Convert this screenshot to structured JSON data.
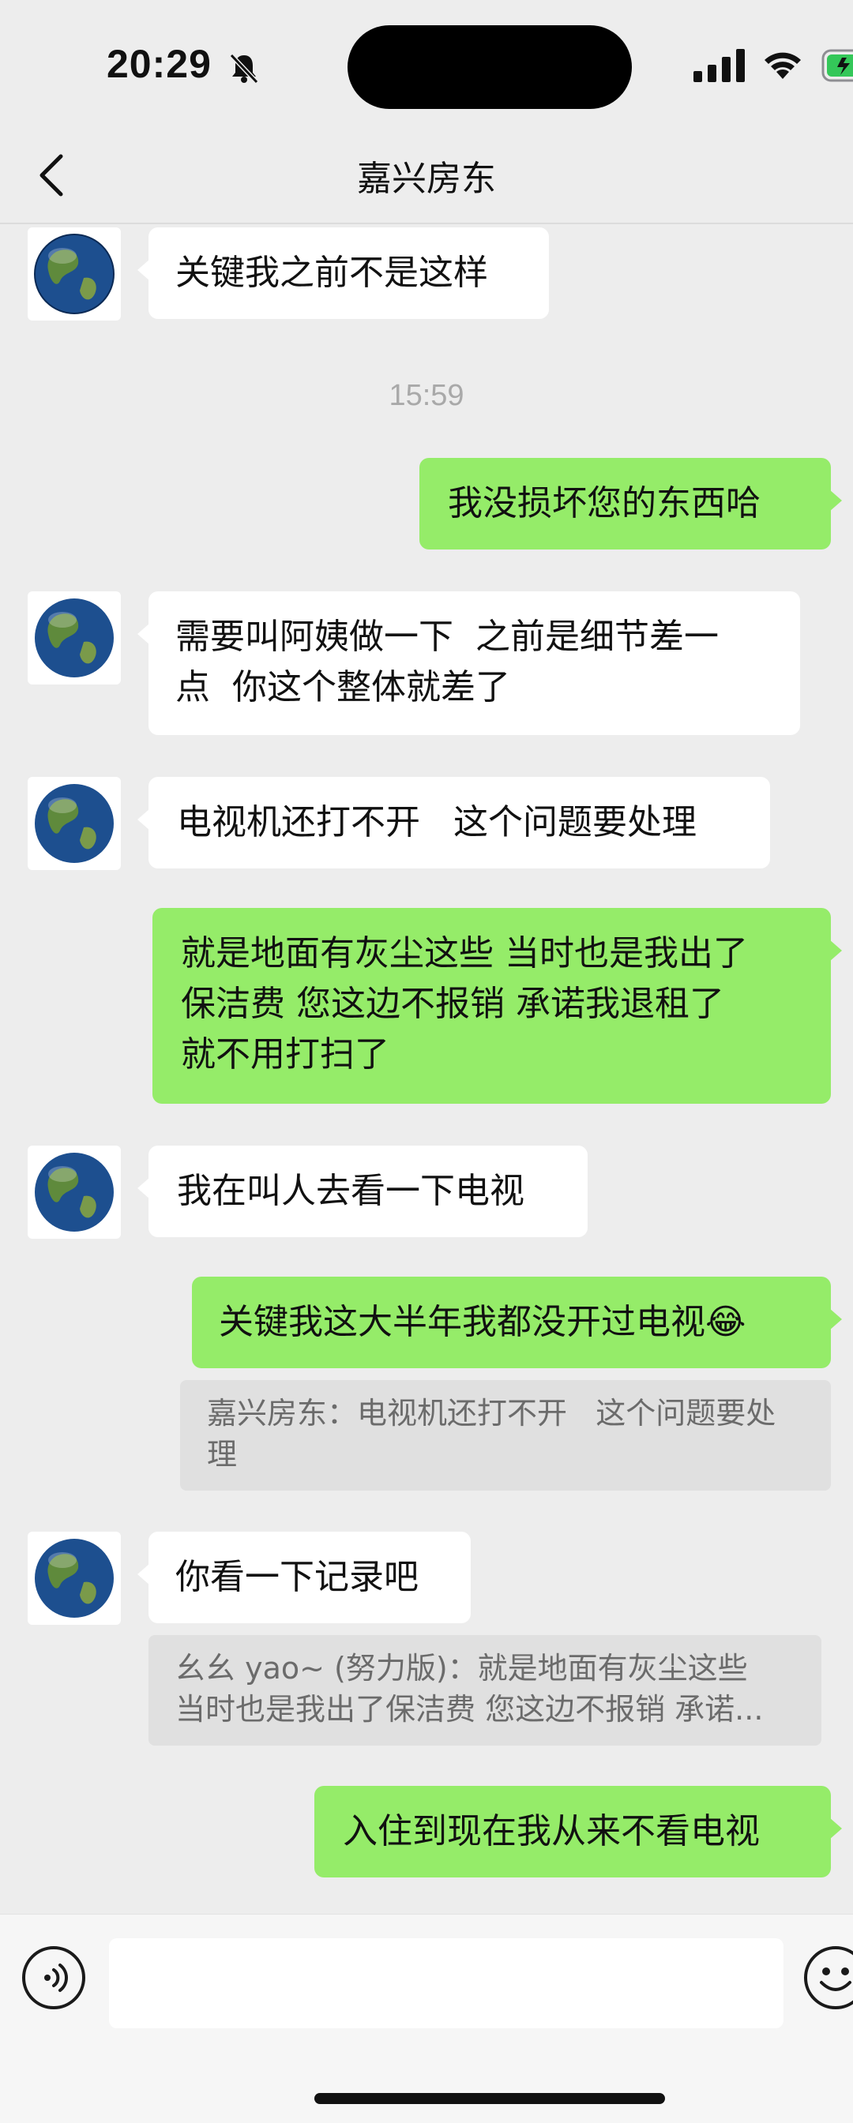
{
  "status_bar": {
    "time": "20:29"
  },
  "nav": {
    "title": "嘉兴房东"
  },
  "messages": [
    {
      "side": "in",
      "text": "关键我之前不是这样"
    },
    {
      "side": "time",
      "text": "15:59"
    },
    {
      "side": "out",
      "text": "我没损坏您的东西哈"
    },
    {
      "side": "in",
      "text": "需要叫阿姨做一下  之前是细节差一\n点  你这个整体就差了"
    },
    {
      "side": "in",
      "text": "电视机还打不开   这个问题要处理"
    },
    {
      "side": "out",
      "text": "就是地面有灰尘这些 当时也是我出了\n保洁费 您这边不报销 承诺我退租了\n就不用打扫了"
    },
    {
      "side": "in",
      "text": "我在叫人去看一下电视"
    },
    {
      "side": "out",
      "text": "关键我这大半年我都没开过电视😂"
    },
    {
      "side": "quote",
      "text": "嘉兴房东：电视机还打不开   这个问题要处\n理"
    },
    {
      "side": "in",
      "text": "你看一下记录吧"
    },
    {
      "side": "quote",
      "text": "幺幺 yao~ (努力版)：就是地面有灰尘这些\n当时也是我出了保洁费 您这边不报销 承诺..."
    },
    {
      "side": "out",
      "text": "入住到现在我从来不看电视"
    }
  ],
  "input": {
    "placeholder": ""
  },
  "colors": {
    "background": "#ededed",
    "outgoing_bubble": "#95ec69",
    "incoming_bubble": "#ffffff",
    "battery": "#34c759"
  },
  "icons": [
    "bell-mute-icon",
    "signal-icon",
    "wifi-icon",
    "battery-icon",
    "back-arrow-icon",
    "globe-avatar-icon",
    "voice-icon",
    "emoji-icon"
  ]
}
